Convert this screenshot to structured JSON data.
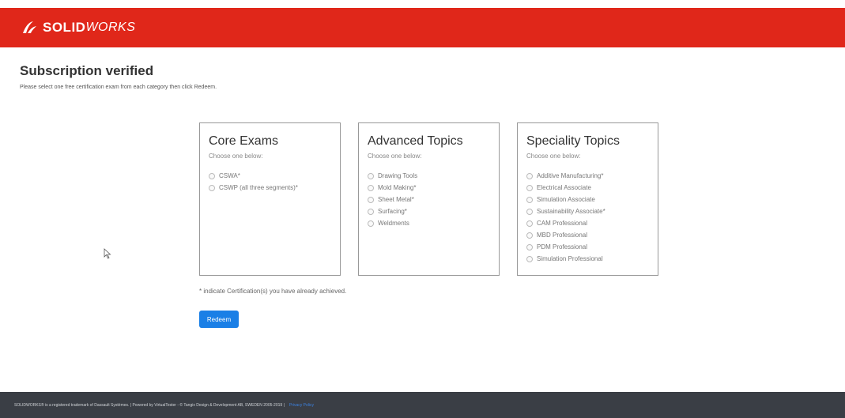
{
  "brand": {
    "logo_bold": "SOLID",
    "logo_light": "WORKS",
    "header_color": "#e0271a"
  },
  "main": {
    "title": "Subscription verified",
    "subtitle": "Please select one free certification exam from each category then click Redeem."
  },
  "categories": [
    {
      "title": "Core Exams",
      "hint": "Choose one below:",
      "options": [
        "CSWA*",
        "CSWP (all three segments)*"
      ]
    },
    {
      "title": "Advanced Topics",
      "hint": "Choose one below:",
      "options": [
        "Drawing Tools",
        "Mold Making*",
        "Sheet Metal*",
        "Surfacing*",
        "Weldments"
      ]
    },
    {
      "title": "Speciality Topics",
      "hint": "Choose one below:",
      "options": [
        "Additive Manufacturing*",
        "Electrical Associate",
        "Simulation Associate",
        "Sustainability Associate*",
        "CAM Professional",
        "MBD Professional",
        "PDM Professional",
        "Simulation Professional"
      ]
    }
  ],
  "note": "* indicate Certification(s) you have already achieved.",
  "redeem_label": "Redeem",
  "redeem_color": "#1a7fe6",
  "footer": {
    "text": "SOLIDWORKS® is a registered trademark of Dassault Systèmes. | Powered by VirtualTester - © Tangix Design & Development AB, SWEDEN 2005-2019 |",
    "link_label": "Privacy Policy",
    "background": "#3a3e45"
  }
}
